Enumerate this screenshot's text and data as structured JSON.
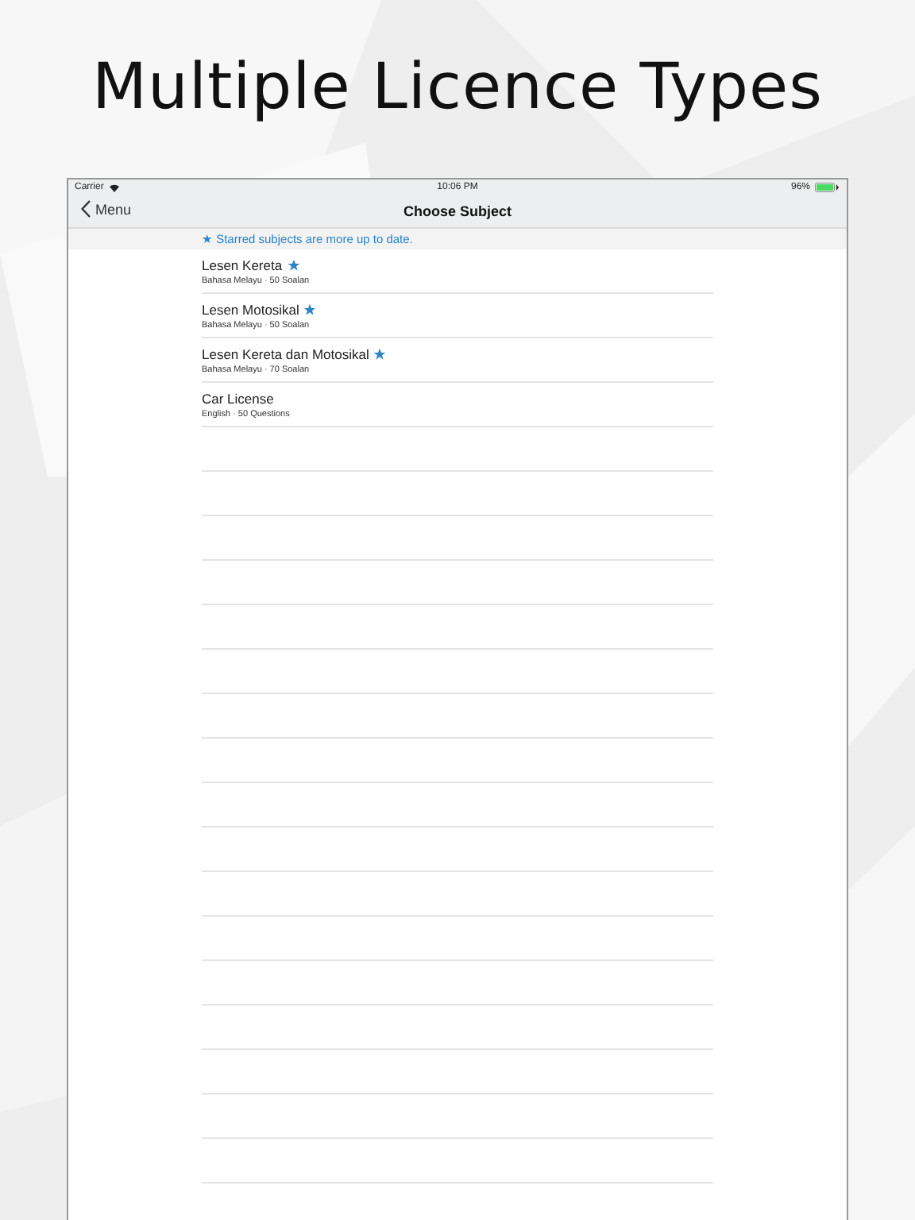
{
  "headline": "Multiple Licence Types",
  "status_bar": {
    "carrier": "Carrier",
    "time": "10:06 PM",
    "battery": "96%"
  },
  "nav": {
    "back": "Menu",
    "title": "Choose Subject"
  },
  "note": "★ Starred subjects are more up to date.",
  "subjects": [
    {
      "title": "Lesen Kereta",
      "subtitle": "Bahasa Melayu · 50 Soalan",
      "starred": true
    },
    {
      "title": "Lesen Motosikal",
      "subtitle": "Bahasa Melayu · 50 Soalan",
      "starred": true
    },
    {
      "title": "Lesen Kereta dan Motosikal",
      "subtitle": "Bahasa Melayu · 70 Soalan",
      "starred": true
    },
    {
      "title": "Car License",
      "subtitle": "English · 50 Questions",
      "starred": false
    }
  ]
}
